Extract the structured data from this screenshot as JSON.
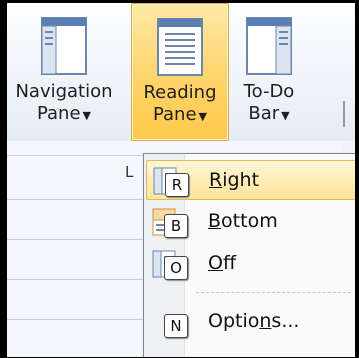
{
  "ribbon": {
    "buttons": [
      {
        "line1": "Navigation",
        "line2": "Pane",
        "icon": "navigation-pane-icon"
      },
      {
        "line1": "Reading",
        "line2": "Pane",
        "icon": "reading-pane-icon",
        "active": true
      },
      {
        "line1": "To-Do",
        "line2": "Bar",
        "icon": "todo-bar-icon"
      }
    ],
    "group_caption_fragment": "L"
  },
  "menu": {
    "items": [
      {
        "pre": "",
        "accel": "R",
        "post": "ight",
        "keytip": "R",
        "icon": "reading-pane-right-icon"
      },
      {
        "pre": "",
        "accel": "B",
        "post": "ottom",
        "keytip": "B",
        "icon": "reading-pane-bottom-icon"
      },
      {
        "pre": "",
        "accel": "O",
        "post": "ff",
        "keytip": "O",
        "icon": "reading-pane-off-icon"
      },
      {
        "pre": "Optio",
        "accel": "n",
        "post": "s...",
        "keytip": "N",
        "icon": ""
      }
    ]
  },
  "colors": {
    "highlight": "#ffd46a",
    "menu_bg": "#fafafa",
    "ribbon_bg": "#edf2f9"
  }
}
